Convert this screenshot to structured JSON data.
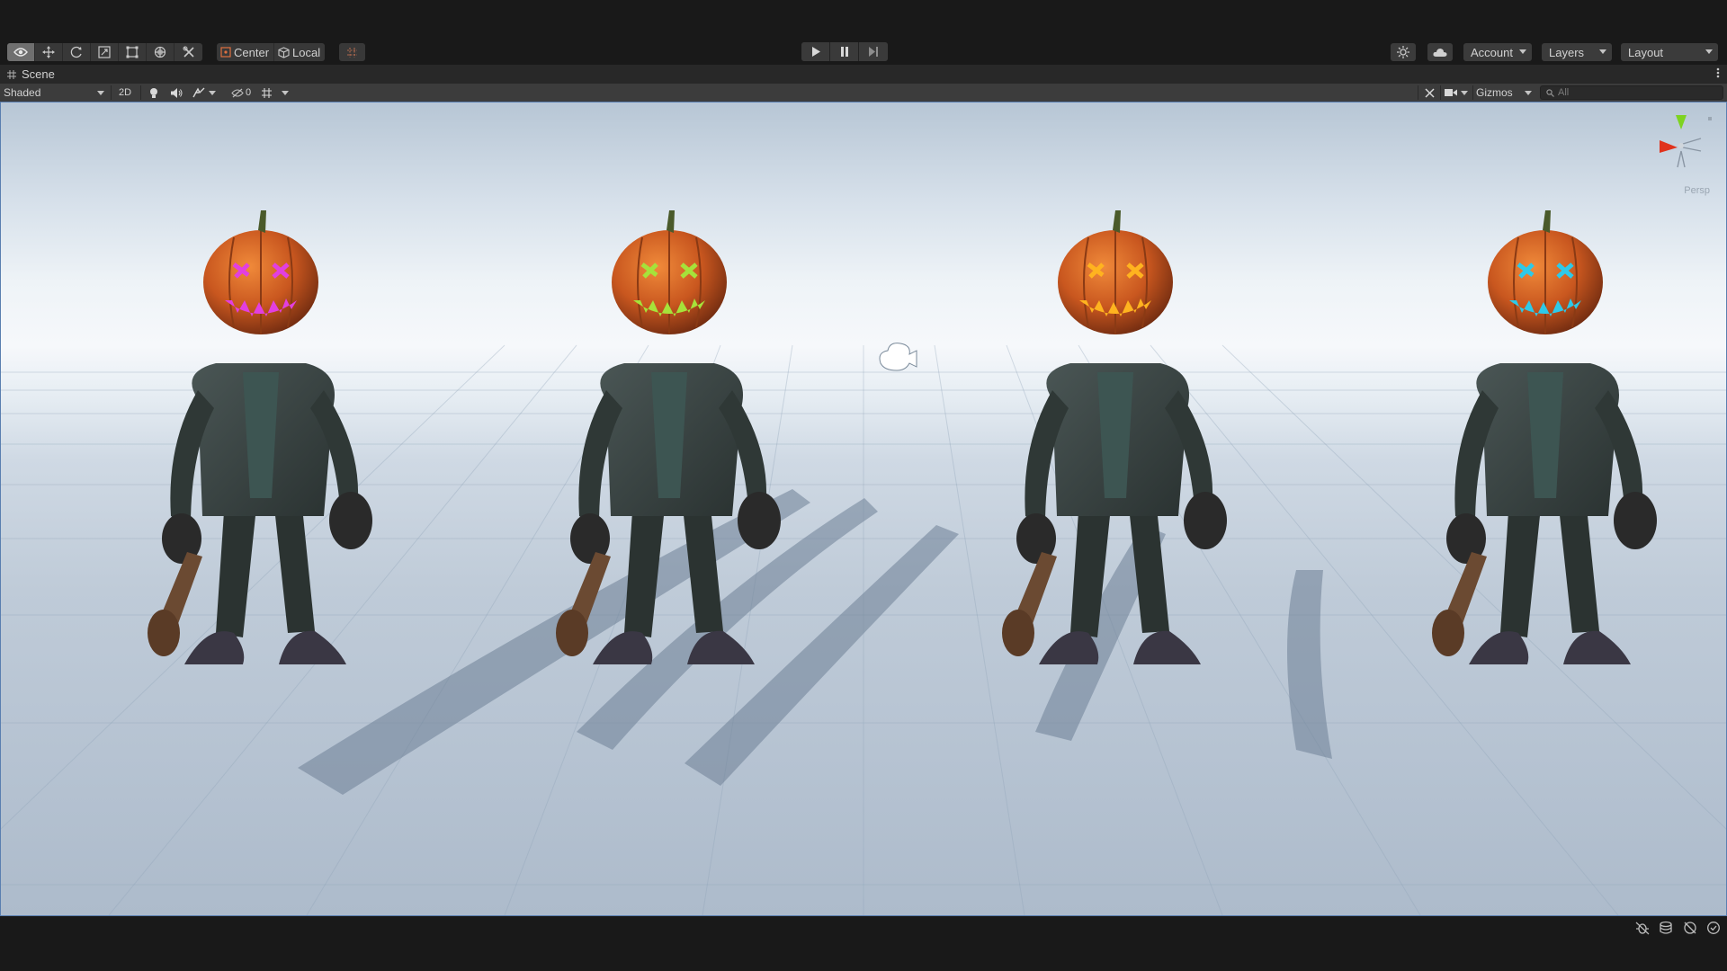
{
  "toolbar": {
    "tools": [
      "view-tool-icon",
      "move-tool-icon",
      "rotate-tool-icon",
      "scale-tool-icon",
      "rect-tool-icon",
      "transform-tool-icon",
      "custom-tool-icon"
    ],
    "pivot_mode_label": "Center",
    "pivot_rotation_label": "Local",
    "account_label": "Account",
    "layers_label": "Layers",
    "layout_label": "Layout"
  },
  "scene_tab": {
    "label": "Scene"
  },
  "scene_toolbar": {
    "draw_mode": "Shaded",
    "mode_2d_label": "2D",
    "hidden_count": "0",
    "gizmos_label": "Gizmos",
    "search_placeholder": "All"
  },
  "viewport": {
    "gizmo_label": "Persp",
    "characters": [
      {
        "name": "pumpkin-head-magenta",
        "glow": "#e23fe0"
      },
      {
        "name": "pumpkin-head-green",
        "glow": "#a6e23a"
      },
      {
        "name": "pumpkin-head-orange",
        "glow": "#ffb31f"
      },
      {
        "name": "pumpkin-head-cyan",
        "glow": "#2ec9e8"
      }
    ]
  },
  "colors": {
    "accent": "#5a7fb0",
    "pumpkin": "#c9571f",
    "suit": "#3b4544"
  }
}
